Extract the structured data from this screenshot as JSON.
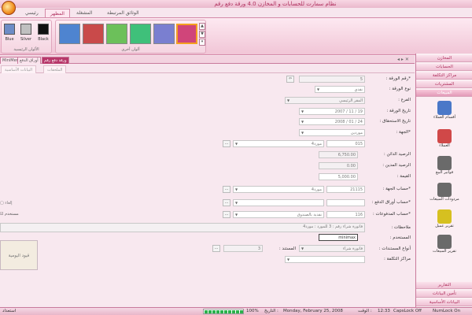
{
  "window": {
    "title": "نظام سمارت للحسابات و المخازن 4.0   ورقة دفع رقم"
  },
  "ribbon": {
    "tabs": [
      {
        "label": "رئيسي"
      },
      {
        "label": "المظهر"
      },
      {
        "label": "المشغلة"
      },
      {
        "label": "الوثائق المرتبطة"
      }
    ],
    "main_colors": {
      "label": "الألوان الرئيسية",
      "items": [
        {
          "label": "Blue",
          "color": "#6d8cc6"
        },
        {
          "label": "Silver",
          "color": "#c0c0c0"
        },
        {
          "label": "Black",
          "color": "#111111"
        }
      ]
    },
    "other_colors": {
      "label": "ألوان أخرى",
      "items": [
        "#4e84d0",
        "#c94a4a",
        "#6cc05a",
        "#3fc07a",
        "#7a7fd0",
        "#d0457a"
      ]
    }
  },
  "doc_tabs": [
    {
      "label": "MiniMer"
    },
    {
      "label": "أوراق الدفع"
    },
    {
      "label": "ورقة دفع رقم"
    }
  ],
  "sub_tabs": [
    {
      "label": "البيانات الأساسية"
    },
    {
      "label": "الملحقات"
    }
  ],
  "form": {
    "paper_no": {
      "label": "*رقم الورقة :",
      "value": "5"
    },
    "paper_type": {
      "label": "نوع الورقة :",
      "value": "نقدي"
    },
    "branch": {
      "label": "الفرع :",
      "value": "المقر الرئيسي"
    },
    "paper_date": {
      "label": "تاريخ الورقة :",
      "value": "19 / 11 / 2007"
    },
    "due_date": {
      "label": "تاريخ الاستحقاق :",
      "value": "24 / 01 / 2008"
    },
    "party": {
      "label": "*الجهة :",
      "value": "موردين"
    },
    "party_code": {
      "value": "015",
      "name": "مورد4"
    },
    "cur_balance": {
      "label": "الرصيد الدائن :",
      "value": "6,750.00"
    },
    "debit_balance": {
      "label": "الرصيد المدين :",
      "value": "0.00"
    },
    "amount": {
      "label": "القيمة :",
      "value": "5,000.00"
    },
    "party_account": {
      "label": "*حساب الجهة :",
      "code": "21115",
      "name": "مورد4"
    },
    "payment_account": {
      "label": "*حساب أوراق الدفع :"
    },
    "payables_account": {
      "label": "*حساب المدفوعات :",
      "code": "116",
      "name": "نقدية بالصندوق"
    },
    "notes": {
      "label": "ملاحظات :",
      "value": "فاتورة شراء رقم : 3 للمورد : مورد4"
    },
    "user": {
      "label": "المستخدم :",
      "value": "minimax"
    },
    "doc_type": {
      "label": "أنواع المستندات :",
      "value": "فاتورة شراء"
    },
    "doc_no": {
      "label": "المستند :",
      "value": "3"
    },
    "cost_centers": {
      "label": "مراكز التكلفة :"
    },
    "cancel_label": "إلغاء",
    "used_label": "مستخدم",
    "journal_button": "قيود اليومية"
  },
  "sidebar": {
    "headers_top": [
      {
        "label": "المخازن"
      },
      {
        "label": "الحسابات"
      },
      {
        "label": "مراكز التكلفة"
      },
      {
        "label": "المشتريات"
      },
      {
        "label": "المبيعات"
      }
    ],
    "items": [
      {
        "label": "أقسام العملاء",
        "color": "#4a78c8"
      },
      {
        "label": "العملاء",
        "color": "#d04848"
      },
      {
        "label": "فواتير البيع",
        "color": "#6a6a6a"
      },
      {
        "label": "مردودات المبيعات",
        "color": "#6a6a6a"
      },
      {
        "label": "تقرير عميل",
        "color": "#d6c020"
      },
      {
        "label": "تقرير المبيعات",
        "color": "#6a6a6a"
      }
    ],
    "headers_bottom": [
      {
        "label": "التقارير"
      },
      {
        "label": "تأمين البيانات"
      },
      {
        "label": "البيانات الأساسية"
      }
    ]
  },
  "status": {
    "capslock": "CapsLock Off",
    "numlock": "NumLock On",
    "time": "12:33",
    "time_label": "الوقت :",
    "date": "Monday, February 25, 2008",
    "date_label": "التاريخ :",
    "percent": "100%",
    "ready": "استعداد",
    "progress": 1.0
  }
}
